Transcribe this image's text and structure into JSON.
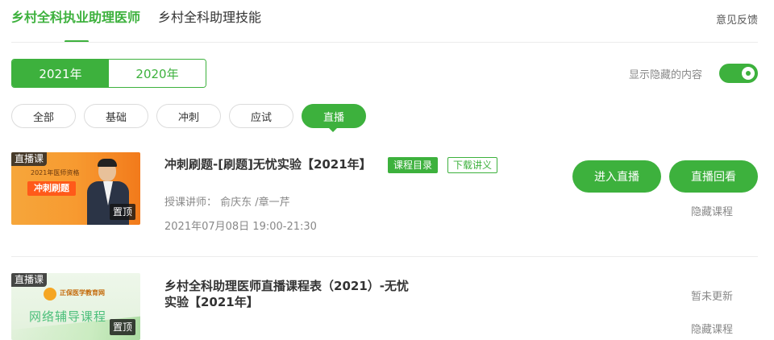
{
  "top_tabs": {
    "active": "乡村全科执业助理医师",
    "other": "乡村全科助理技能",
    "feedback": "意见反馈"
  },
  "years": [
    "2021年",
    "2020年"
  ],
  "show_hidden": {
    "label": "显示隐藏的内容",
    "on": true
  },
  "filters": [
    "全部",
    "基础",
    "冲刺",
    "应试",
    "直播"
  ],
  "active_filter": "直播",
  "courses": [
    {
      "badge": "直播课",
      "pin": "置顶",
      "thumb_title": "2021年医师资格",
      "thumb_banner": "冲刺刷题",
      "title": "冲刺刷题-[刷题]无忧实验【2021年】",
      "tag_catalog": "课程目录",
      "tag_download": "下载讲义",
      "teachers": "授课讲师： 俞庆东 /章一芹",
      "time": "2021年07月08日 19:00-21:30",
      "btn_live": "进入直播",
      "btn_replay": "直播回看",
      "hide": "隐藏课程"
    },
    {
      "badge": "直播课",
      "pin": "置顶",
      "thumb_logo": "正保医学教育网",
      "thumb_main": "网络辅导课程",
      "title_line1": "乡村全科助理医师直播课程表（2021）-无忧",
      "title_line2": "实验【2021年】",
      "status": "暂未更新",
      "hide": "隐藏课程"
    }
  ],
  "colors": {
    "accent": "#3db13d",
    "orange": "#f79a30"
  }
}
